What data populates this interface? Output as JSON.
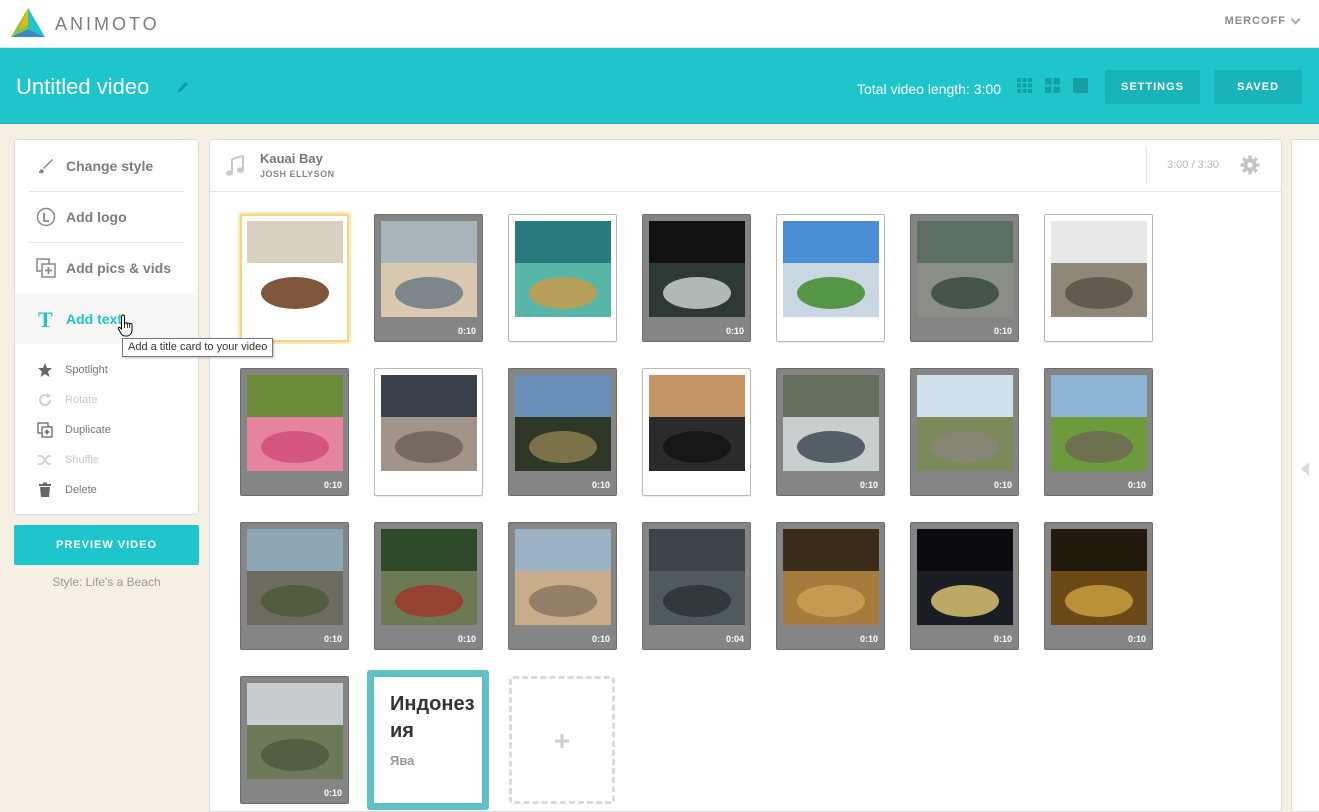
{
  "brand": {
    "logo_text": "ANIMOTO"
  },
  "account": {
    "username": "MERCOFF"
  },
  "header": {
    "title": "Untitled video",
    "total_length": "Total video length: 3:00",
    "settings_label": "SETTINGS",
    "saved_label": "SAVED"
  },
  "sidebar": {
    "main_items": [
      {
        "label": "Change style",
        "icon": "brush-icon"
      },
      {
        "label": "Add logo",
        "icon": "logo-icon"
      },
      {
        "label": "Add pics & vids",
        "icon": "add-media-icon"
      },
      {
        "label": "Add text",
        "icon": "text-icon"
      }
    ],
    "tooltip": "Add a title card to your video",
    "small_items": [
      {
        "label": "Spotlight",
        "icon": "star-icon",
        "enabled": true
      },
      {
        "label": "Rotate",
        "icon": "rotate-icon",
        "enabled": false
      },
      {
        "label": "Duplicate",
        "icon": "duplicate-icon",
        "enabled": true
      },
      {
        "label": "Shuffle",
        "icon": "shuffle-icon",
        "enabled": false
      },
      {
        "label": "Delete",
        "icon": "trash-icon",
        "enabled": true
      }
    ]
  },
  "preview": {
    "label": "PREVIEW VIDEO",
    "style_label": "Style: Life's a Beach"
  },
  "music": {
    "song": "Kauai Bay",
    "artist": "JOSH ELLYSON",
    "duration": "3:00 / 3:30"
  },
  "tiles": [
    {
      "type": "photo",
      "duration": "",
      "selected": true
    },
    {
      "type": "video",
      "duration": "0:10"
    },
    {
      "type": "photo",
      "duration": ""
    },
    {
      "type": "video",
      "duration": "0:10"
    },
    {
      "type": "photo",
      "duration": ""
    },
    {
      "type": "video",
      "duration": "0:10"
    },
    {
      "type": "photo",
      "duration": ""
    },
    {
      "type": "video",
      "duration": "0:10"
    },
    {
      "type": "photo",
      "duration": ""
    },
    {
      "type": "video",
      "duration": "0:10"
    },
    {
      "type": "photo",
      "duration": ""
    },
    {
      "type": "video",
      "duration": "0:10"
    },
    {
      "type": "video",
      "duration": "0:10"
    },
    {
      "type": "video",
      "duration": "0:10"
    },
    {
      "type": "video",
      "duration": "0:10"
    },
    {
      "type": "video",
      "duration": "0:10"
    },
    {
      "type": "video",
      "duration": "0:10"
    },
    {
      "type": "video",
      "duration": "0:04"
    },
    {
      "type": "video",
      "duration": "0:10"
    },
    {
      "type": "video",
      "duration": "0:10"
    },
    {
      "type": "video",
      "duration": "0:10"
    },
    {
      "type": "video",
      "duration": "0:10"
    }
  ],
  "text_card": {
    "title": "Индонезия",
    "subtitle": "Ява"
  },
  "add_tile": {
    "symbol": "+"
  },
  "colors": {
    "accent": "#1ec5cb",
    "selected_border": "#f2d680",
    "text_card_border": "#62c1c5"
  }
}
